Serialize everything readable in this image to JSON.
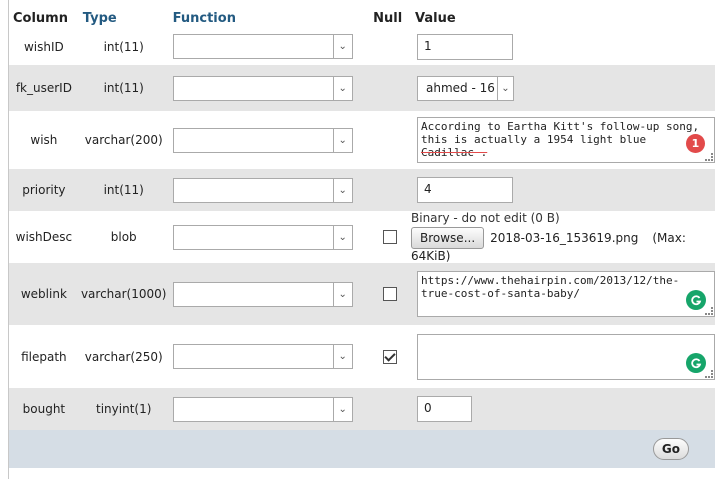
{
  "headers": {
    "column": "Column",
    "type": "Type",
    "function": "Function",
    "null": "Null",
    "value": "Value"
  },
  "rows": [
    {
      "column": "wishID",
      "type": "int(11)",
      "value": "1"
    },
    {
      "column": "fk_userID",
      "type": "int(11)",
      "value": "ahmed - 16"
    },
    {
      "column": "wish",
      "type": "varchar(200)",
      "value_lines": [
        "According to Eartha Kitt's follow-up song,",
        "this is actually a 1954 light blue",
        "Cadillac ."
      ],
      "badge": "1"
    },
    {
      "column": "priority",
      "type": "int(11)",
      "value": "4"
    },
    {
      "column": "wishDesc",
      "type": "blob",
      "binary_note": "Binary - do not edit (0 B)",
      "browse_label": "Browse...",
      "filename": "2018-03-16_153619.png",
      "max_size": "(Max: 64KiB)"
    },
    {
      "column": "weblink",
      "type": "varchar(1000)",
      "value": "https://www.thehairpin.com/2013/12/the-\ntrue-cost-of-santa-baby/"
    },
    {
      "column": "filepath",
      "type": "varchar(250)",
      "value": ""
    },
    {
      "column": "bought",
      "type": "tinyint(1)",
      "value": "0"
    }
  ],
  "null_checks": {
    "wishDesc": false,
    "weblink": false,
    "filepath": true
  },
  "go_label": "Go",
  "icons": {
    "dropdown": "chevron-down-icon",
    "grammarly": "grammarly-icon",
    "resize": "resize-grip-icon"
  },
  "colors": {
    "header_link": "#235a81",
    "row_alt": "#e5e5e5",
    "footer": "#d5dde5",
    "badge_red": "#e24a4a",
    "badge_green": "#16a56a"
  }
}
